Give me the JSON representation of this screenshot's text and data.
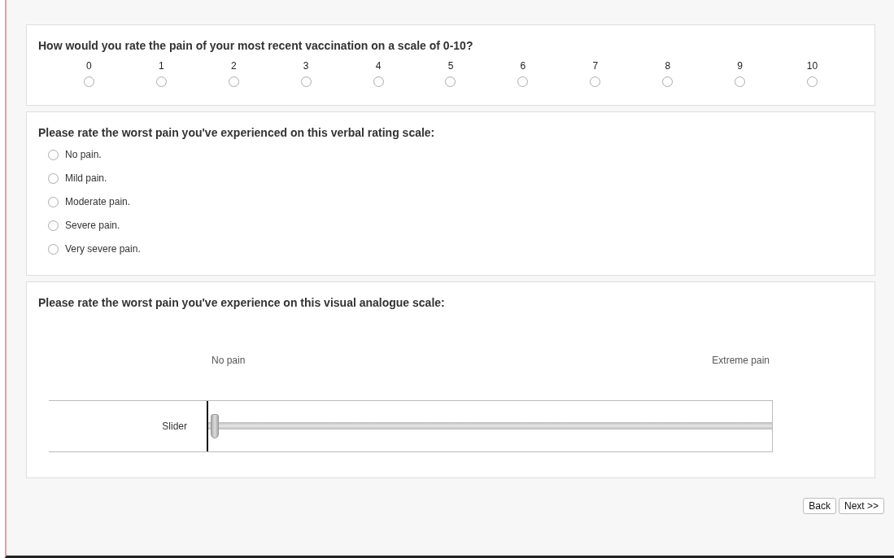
{
  "questions": [
    {
      "kind": "scale",
      "title": "How would you rate the pain of your most recent vaccination on a scale of 0-10?",
      "options": [
        {
          "label": "0",
          "selected": false
        },
        {
          "label": "1",
          "selected": false
        },
        {
          "label": "2",
          "selected": false
        },
        {
          "label": "3",
          "selected": false
        },
        {
          "label": "4",
          "selected": false
        },
        {
          "label": "5",
          "selected": false
        },
        {
          "label": "6",
          "selected": false
        },
        {
          "label": "7",
          "selected": false
        },
        {
          "label": "8",
          "selected": false
        },
        {
          "label": "9",
          "selected": false
        },
        {
          "label": "10",
          "selected": false
        }
      ]
    },
    {
      "kind": "list",
      "title": "Please rate the worst pain you've experienced on this verbal rating scale:",
      "options": [
        {
          "label": "No pain.",
          "selected": false
        },
        {
          "label": "Mild pain.",
          "selected": false
        },
        {
          "label": "Moderate pain.",
          "selected": false
        },
        {
          "label": "Severe pain.",
          "selected": false
        },
        {
          "label": "Very severe pain.",
          "selected": false
        }
      ]
    },
    {
      "kind": "slider",
      "title": "Please rate the worst pain you've experience on this visual analogue scale:",
      "min_label": "No pain",
      "max_label": "Extreme pain",
      "slider_label": "Slider",
      "level": 0
    }
  ],
  "buttons": [
    "Back",
    "Next >>"
  ]
}
